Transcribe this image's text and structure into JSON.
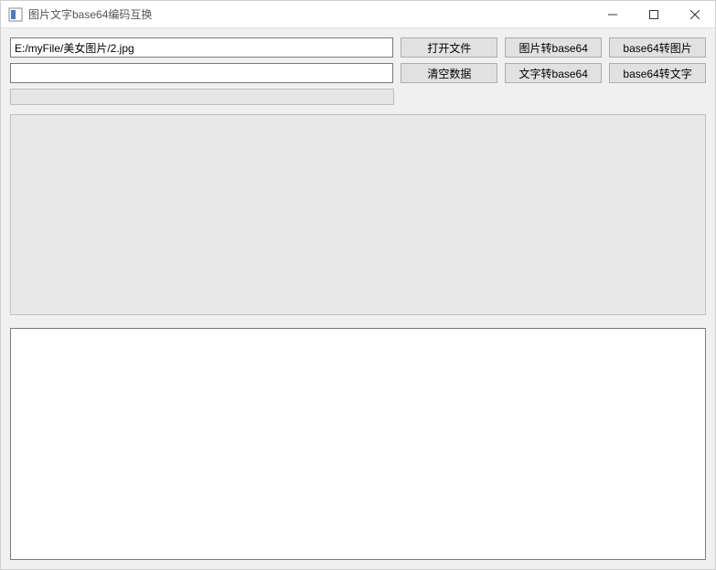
{
  "window": {
    "title": "图片文字base64编码互换"
  },
  "inputs": {
    "file_path": "E:/myFile/美女图片/2.jpg",
    "text_value": ""
  },
  "buttons": {
    "open_file": "打开文件",
    "image_to_base64": "图片转base64",
    "base64_to_image": "base64转图片",
    "clear_data": "清空数据",
    "text_to_base64": "文字转base64",
    "base64_to_text": "base64转文字"
  },
  "output": {
    "value": ""
  }
}
